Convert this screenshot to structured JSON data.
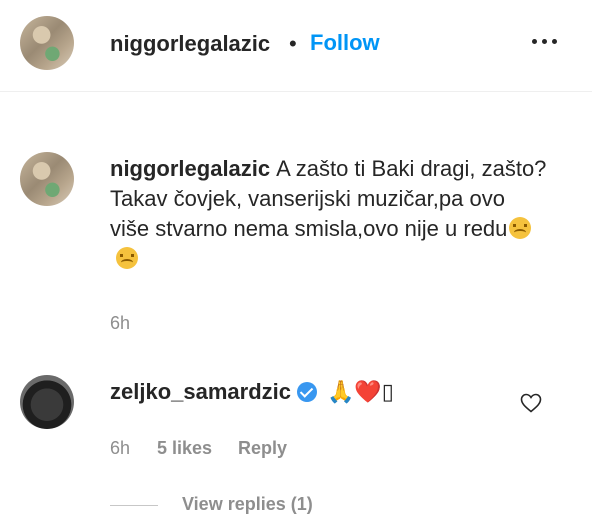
{
  "post_header": {
    "username": "niggorlegalazic",
    "separator": "•",
    "follow_label": "Follow",
    "more_icon": "more-options-icon"
  },
  "comment": {
    "username": "niggorlegalazic",
    "text": "A zašto ti Baki dragi, zašto?Takav čovjek, vanserijski muzičar,pa ovo više stvarno nema smisla,ovo nije u redu",
    "emoji_1": "sad-tear-emoji",
    "emoji_2": "sad-tear-emoji",
    "time": "6h"
  },
  "reply": {
    "username": "zeljko_samardzic",
    "verified_icon": "verified-badge-icon",
    "emoji_text": "🙏❤️▯",
    "time": "6h",
    "likes": "5 likes",
    "reply_label": "Reply",
    "like_icon": "heart-outline-icon"
  },
  "view_replies_label": "View replies (1)",
  "colors": {
    "accent": "#0095f6",
    "text": "#262626",
    "muted": "#8e8e8e",
    "verified": "#3897f0"
  }
}
